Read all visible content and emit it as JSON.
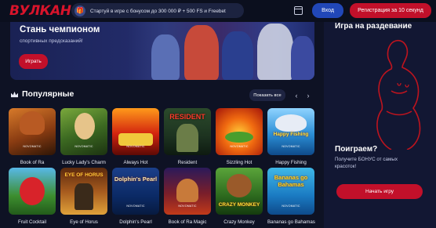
{
  "header": {
    "logo": "ВУЛКАН",
    "promo_text": "Стартуй в игре с бонусом до 300 000 ₽ + 500 FS и Freebet",
    "login_label": "Вход",
    "register_label": "Регистрация за 10 секунд"
  },
  "banner": {
    "title": "Стань чемпионом",
    "subtitle": "спортивных предсказаний!",
    "button_label": "Играть"
  },
  "popular": {
    "title": "Популярные",
    "show_all_label": "Показать все",
    "prev_arrow": "‹",
    "next_arrow": "›"
  },
  "games": [
    {
      "name": "Book of Ra",
      "maker": "NOVOMATIC",
      "logo": ""
    },
    {
      "name": "Lucky Lady's Charm",
      "maker": "NOVOMATIC",
      "logo": ""
    },
    {
      "name": "Always Hot",
      "maker": "NOVOMATIC",
      "logo": ""
    },
    {
      "name": "Resident",
      "maker": "",
      "logo": "RESIDENT"
    },
    {
      "name": "Sizzling Hot",
      "maker": "NOVOMATIC",
      "logo": ""
    },
    {
      "name": "Happy Fishing",
      "maker": "NOVOMATIC",
      "logo": "Happy Fishing"
    },
    {
      "name": "Fruit Cocktail",
      "maker": "",
      "logo": ""
    },
    {
      "name": "Eye of Horus",
      "maker": "",
      "logo": "EYE OF HORUS"
    },
    {
      "name": "Dolphin's Pearl",
      "maker": "NOVOMATIC",
      "logo": "Dolphin's Pearl"
    },
    {
      "name": "Book of Ra Magic",
      "maker": "NOVOMATIC",
      "logo": ""
    },
    {
      "name": "Crazy Monkey",
      "maker": "",
      "logo": "CRAZY MONKEY"
    },
    {
      "name": "Bananas go Bahamas",
      "maker": "NOVOMATIC",
      "logo": "Bananas go Bahamas"
    }
  ],
  "side_panel": {
    "title": "Игра на раздевание",
    "promo_title": "Поиграем?",
    "promo_text": "Получите БОНУС от самых красоток!",
    "button_label": "Начать игру"
  },
  "colors": {
    "background": "#0e1224",
    "accent_red": "#c2102a",
    "accent_blue": "#2147b8"
  }
}
